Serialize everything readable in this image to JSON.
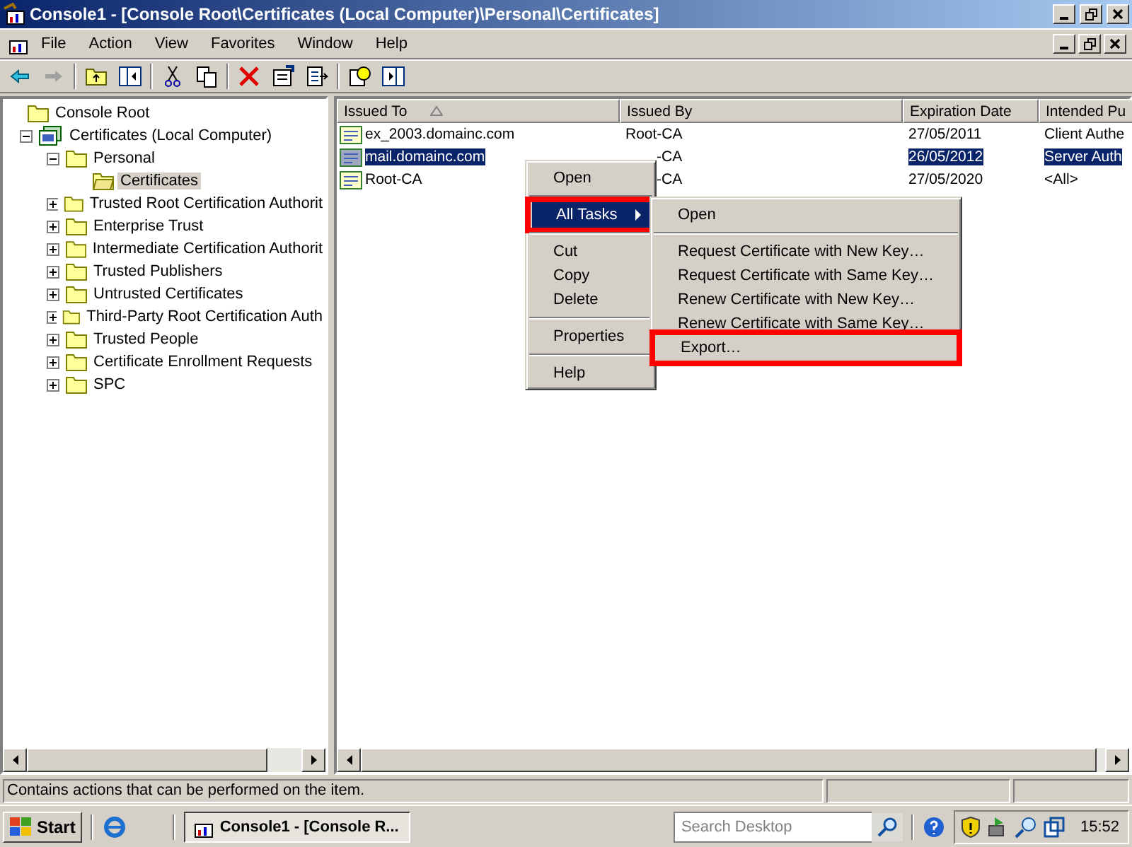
{
  "window": {
    "title": "Console1 - [Console Root\\Certificates (Local Computer)\\Personal\\Certificates]"
  },
  "menu_bar": [
    {
      "label": "File"
    },
    {
      "label": "Action"
    },
    {
      "label": "View"
    },
    {
      "label": "Favorites"
    },
    {
      "label": "Window"
    },
    {
      "label": "Help"
    }
  ],
  "tree": [
    {
      "label": "Console Root",
      "kind": "folder",
      "selected": false,
      "children": [
        {
          "label": "Certificates (Local Computer)",
          "kind": "store",
          "expanded": true,
          "selected": false,
          "children": [
            {
              "label": "Personal",
              "kind": "folder",
              "expanded": true,
              "selected": false,
              "children": [
                {
                  "label": "Certificates",
                  "kind": "openfolder",
                  "selected": true
                }
              ]
            },
            {
              "label": "Trusted Root Certification Authorit",
              "kind": "folder",
              "expanded": false,
              "selected": false
            },
            {
              "label": "Enterprise Trust",
              "kind": "folder",
              "expanded": false,
              "selected": false
            },
            {
              "label": "Intermediate Certification Authorit",
              "kind": "folder",
              "expanded": false,
              "selected": false
            },
            {
              "label": "Trusted Publishers",
              "kind": "folder",
              "expanded": false,
              "selected": false
            },
            {
              "label": "Untrusted Certificates",
              "kind": "folder",
              "expanded": false,
              "selected": false
            },
            {
              "label": "Third-Party Root Certification Auth",
              "kind": "folder",
              "expanded": false,
              "selected": false
            },
            {
              "label": "Trusted People",
              "kind": "folder",
              "expanded": false,
              "selected": false
            },
            {
              "label": "Certificate Enrollment Requests",
              "kind": "folder",
              "expanded": false,
              "selected": false
            },
            {
              "label": "SPC",
              "kind": "folder",
              "expanded": false,
              "selected": false
            }
          ]
        }
      ]
    }
  ],
  "list": {
    "columns": [
      {
        "label": "Issued To",
        "sorted": true
      },
      {
        "label": "Issued By"
      },
      {
        "label": "Expiration Date"
      },
      {
        "label": "Intended Pu"
      }
    ],
    "rows": [
      {
        "selected": false,
        "cells": [
          "ex_2003.domainc.com",
          "Root-CA",
          "27/05/2011",
          "Client Authe"
        ]
      },
      {
        "selected": true,
        "cells": [
          "mail.domainc.com",
          {
            "text": "-CA",
            "covered": true
          },
          "26/05/2012",
          "Server Auth"
        ]
      },
      {
        "selected": false,
        "cells": [
          "Root-CA",
          {
            "text": "-CA",
            "covered": true
          },
          "27/05/2020",
          "<All>"
        ]
      }
    ]
  },
  "context_menu": {
    "items": [
      {
        "kind": "item",
        "label": "Open",
        "selected": false,
        "highlighted": false
      },
      {
        "kind": "separator"
      },
      {
        "kind": "submenu",
        "label": "All Tasks",
        "selected": true,
        "highlighted": true
      },
      {
        "kind": "separator"
      },
      {
        "kind": "item",
        "label": "Cut",
        "selected": false,
        "highlighted": false
      },
      {
        "kind": "item",
        "label": "Copy",
        "selected": false,
        "highlighted": false
      },
      {
        "kind": "item",
        "label": "Delete",
        "selected": false,
        "highlighted": false
      },
      {
        "kind": "separator"
      },
      {
        "kind": "item",
        "label": "Properties",
        "selected": false,
        "highlighted": false
      },
      {
        "kind": "separator"
      },
      {
        "kind": "item",
        "label": "Help",
        "selected": false,
        "highlighted": false
      }
    ]
  },
  "submenu": {
    "items": [
      {
        "kind": "item",
        "label": "Open",
        "highlighted": false
      },
      {
        "kind": "separator"
      },
      {
        "kind": "item",
        "label": "Request Certificate with New Key…",
        "highlighted": false
      },
      {
        "kind": "item",
        "label": "Request Certificate with Same Key…",
        "highlighted": false
      },
      {
        "kind": "item",
        "label": "Renew Certificate with New Key…",
        "highlighted": false
      },
      {
        "kind": "item",
        "label": "Renew Certificate with Same Key…",
        "highlighted": false
      },
      {
        "kind": "item",
        "label": "Export…",
        "highlighted": true
      }
    ]
  },
  "status_bar": {
    "text": "Contains actions that can be performed on the item."
  },
  "taskbar": {
    "start": "Start",
    "task": "Console1 - [Console R...",
    "search": {
      "placeholder": "Search Desktop"
    },
    "clock": "15:52"
  }
}
